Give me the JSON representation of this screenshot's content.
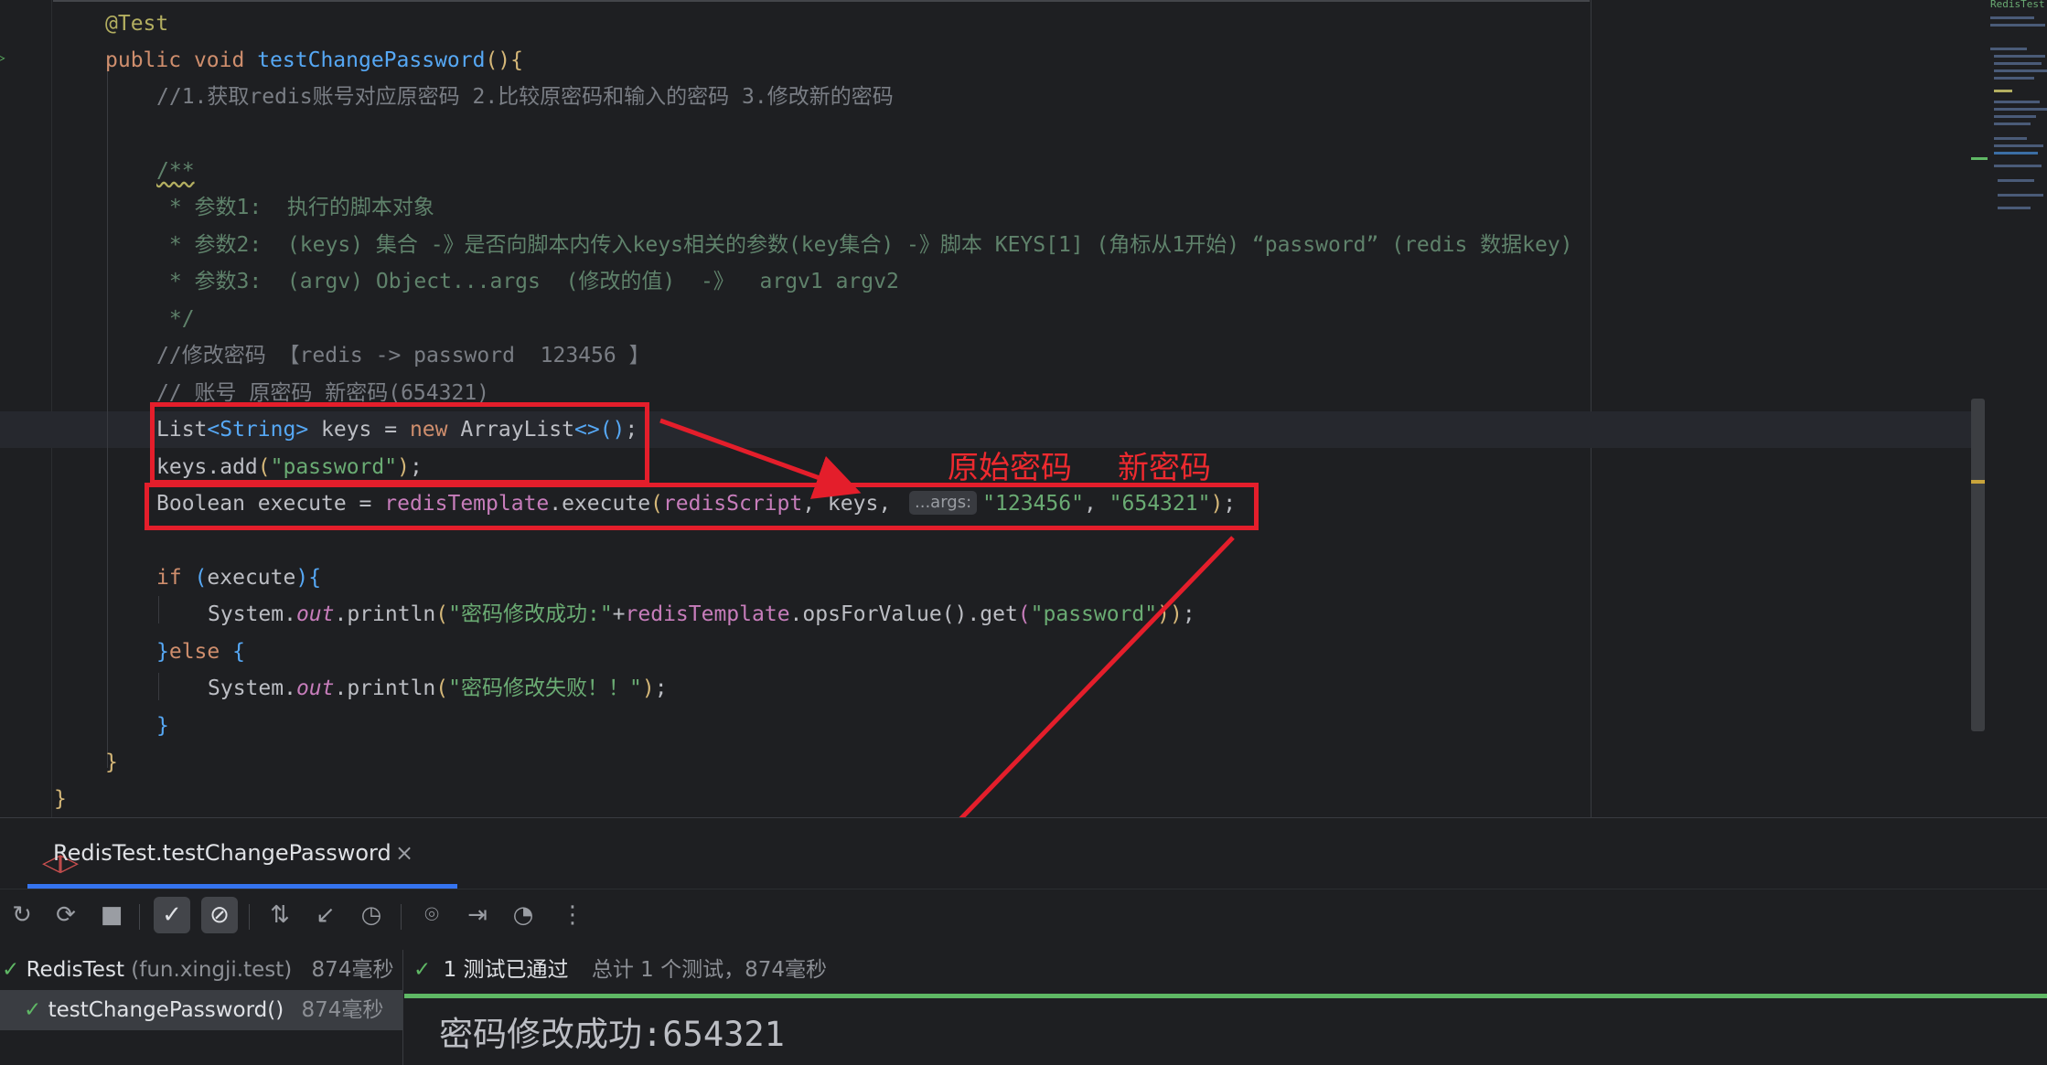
{
  "editor": {
    "annotation_test": "@Test",
    "method_sig": {
      "kw_public": "public",
      "kw_void": "void",
      "name": "testChangePassword",
      "paren": "()",
      "brace": "{"
    },
    "comment_steps": "//1.获取redis账号对应原密码 2.比较原密码和输入的密码 3.修改新的密码",
    "doc_open": "/**",
    "doc_param1": " * 参数1:  执行的脚本对象",
    "doc_param2": " * 参数2:  (keys) 集合 -》是否向脚本内传入keys相关的参数(key集合) -》脚本 KEYS[1] (角标从1开始) “password” (redis 数据key)",
    "doc_param3": " * 参数3:  (argv) Object...args  (修改的值)  -》  argv1 argv2",
    "doc_close": " */",
    "comment_modify": "//修改密码 【redis -> password  123456 】",
    "comment_account": "// 账号 原密码 新密码(654321)",
    "line_keys": {
      "type": "List",
      "generic": "<String>",
      "rest": " keys = ",
      "kw_new": "new",
      "cls": " ArrayList",
      "diamond": "<>",
      "paren": "()",
      "semi": ";"
    },
    "line_add": {
      "obj": "keys.add",
      "open": "(",
      "str": "\"password\"",
      "close": ")",
      "semi": ";"
    },
    "line_execute": {
      "decl": "Boolean execute = ",
      "field": "redisTemplate",
      "call": ".execute",
      "open": "(",
      "arg1": "redisScript",
      "arg2": ", keys, ",
      "hint": "...args:",
      "str1": "\"123456\"",
      "comma": ", ",
      "str2": "\"654321\"",
      "close": ")",
      "semi": ";"
    },
    "line_if": {
      "kw": "if",
      "open": " (",
      "cond": "execute",
      "close": ")",
      "brace": "{"
    },
    "line_print_ok": {
      "obj": "System.",
      "out": "out",
      "call": ".println",
      "open": "(",
      "str": "\"密码修改成功:\"",
      "plus": "+",
      "field": "redisTemplate",
      "rest": ".opsForValue().get",
      "open2": "(",
      "str2": "\"password\"",
      "close": "))",
      "semi": ";"
    },
    "line_else": {
      "brace_close": "}",
      "kw": "else",
      "brace": " {"
    },
    "line_print_fail": {
      "obj": "System.",
      "out": "out",
      "call": ".println",
      "open": "(",
      "str": "\"密码修改失败！！\"",
      "close": ")",
      "semi": ";"
    },
    "close_inner": "}",
    "close_method": "}",
    "close_class": "}"
  },
  "annotations": {
    "original_password_label": "原始密码",
    "new_password_label": "新密码",
    "color": "#e41e2b"
  },
  "minimap": {
    "title": "RedisTest"
  },
  "run_panel": {
    "tab_label": "RedisTest.testChangePassword",
    "tab_icon": "test-run-icon",
    "tree": [
      {
        "name": "RedisTest",
        "pkg": "(fun.xingji.test)",
        "time": "874毫秒"
      },
      {
        "name": "testChangePassword()",
        "time": "874毫秒"
      }
    ],
    "status": {
      "passed": "1 测试已通过",
      "summary": "总计 1 个测试，874毫秒"
    },
    "output": {
      "prefix": "密码修改成功:",
      "value": "654321"
    },
    "colors": {
      "pass": "#5fb865",
      "accent": "#3574f0"
    }
  }
}
